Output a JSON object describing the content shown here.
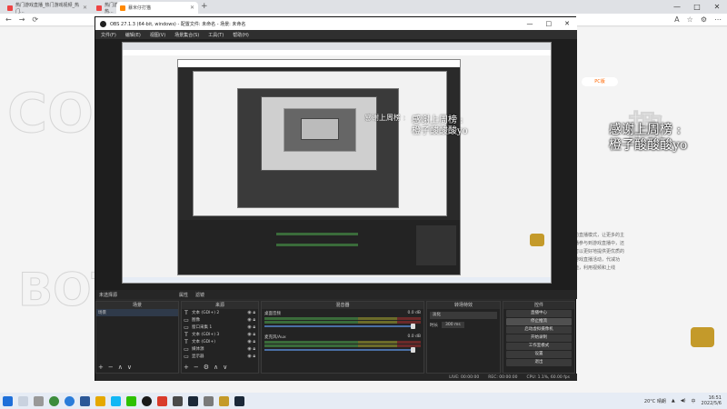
{
  "browser": {
    "tabs": [
      {
        "label": "热门游戏直播_热门游戏视频_热门..."
      },
      {
        "label": "热门游戏直播_热门游戏视频_热..."
      },
      {
        "label": "暴米仔打猫"
      }
    ],
    "new_tab": "+",
    "window_controls": [
      "—",
      "□",
      "✕"
    ],
    "nav": [
      "←",
      "→",
      "⟳"
    ],
    "right_icons": [
      "A",
      "☆",
      "⚙",
      "⋯"
    ]
  },
  "page": {
    "side_text": "的直播模式，让更多的主播参与到游戏直播中，还可以更好地提供更优质的游戏直播活动，代减功能，利用视频和上线",
    "stream_title_line1": "感谢上周榜  :",
    "stream_title_line2": "橙子酸酸酸yo",
    "bg_badge": "PC版"
  },
  "obs": {
    "title": "OBS 27.1.3 (64-bit, windows) - 配置文件: 未命名 - 场景: 未命名",
    "window_controls": [
      "—",
      "□",
      "✕"
    ],
    "menu": [
      "文件(F)",
      "编辑(E)",
      "视图(V)",
      "场景集合(S)",
      "工具(T)",
      "帮助(H)"
    ],
    "bar_label": "未选择源",
    "bar_items": [
      "属性",
      "滤镜"
    ],
    "scenes": {
      "header": "场景",
      "items": [
        "场景"
      ]
    },
    "sources": {
      "header": "来源",
      "items": [
        {
          "icon": "T",
          "name": "文本 (GDI+) 2"
        },
        {
          "icon": "▭",
          "name": "图像"
        },
        {
          "icon": "▭",
          "name": "窗口采集 1"
        },
        {
          "icon": "T",
          "name": "文本 (GDI+) 3"
        },
        {
          "icon": "T",
          "name": "文本 (GDI+)"
        },
        {
          "icon": "▭",
          "name": "媒体源"
        },
        {
          "icon": "▭",
          "name": "显示器"
        }
      ]
    },
    "mixer": {
      "header": "混音器",
      "channels": [
        {
          "name": "桌面音频",
          "db": "0.0 dB",
          "level": 0.85
        },
        {
          "name": "麦克风/Aux",
          "db": "0.0 dB",
          "level": 0.85
        }
      ]
    },
    "transitions": {
      "header": "转场特效",
      "type": "淡化",
      "duration_label": "时长",
      "duration_value": "300 ms"
    },
    "controls": {
      "header": "控件",
      "buttons": [
        "直播中心",
        "停止推流",
        "启动虚拟摄像机",
        "开始录制",
        "工作室模式",
        "设置",
        "退出"
      ]
    },
    "status": [
      "LIVE: 00:00:00",
      "REC: 00:00:00",
      "CPU: 1.1%, 60.00 fps"
    ],
    "dock_buttons": [
      "+",
      "−",
      "⚙",
      "∧",
      "∨"
    ]
  },
  "taskbar": {
    "weather": "20°C 晴朗",
    "time": "16:51",
    "date": "2022/5/6",
    "lang": "中"
  }
}
